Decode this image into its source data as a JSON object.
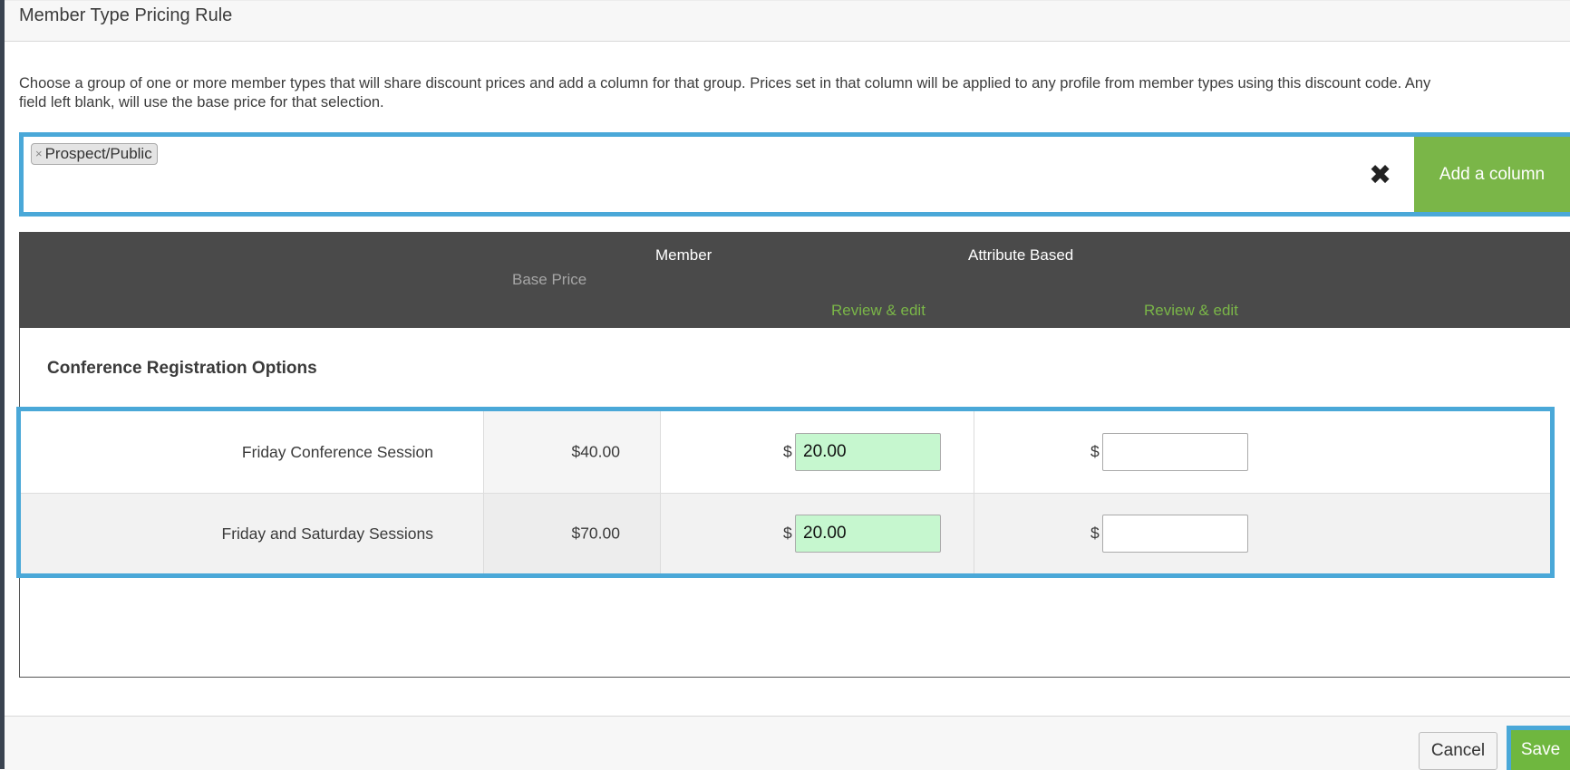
{
  "header": {
    "title": "Member Type Pricing Rule"
  },
  "description": {
    "line1": "Choose a group of one or more member types that will share discount prices and add a column for that group. Prices set in that column will be applied to any profile from member types using this discount code. Any",
    "line2": "field left blank, will use the base price for that selection."
  },
  "selector": {
    "tags": [
      {
        "label": "Prospect/Public",
        "remove_symbol": "×"
      }
    ],
    "clear_symbol": "✖",
    "add_column_label": "Add a column"
  },
  "grid": {
    "columns": {
      "base_price": "Base Price",
      "member": "Member",
      "attribute_based": "Attribute Based",
      "review_edit": "Review & edit"
    },
    "section_title": "Conference Registration Options",
    "currency_symbol": "$",
    "rows": [
      {
        "label": "Friday Conference Session",
        "base_price": "$40.00",
        "member_price": "20.00",
        "attribute_price": ""
      },
      {
        "label": "Friday and Saturday Sessions",
        "base_price": "$70.00",
        "member_price": "20.00",
        "attribute_price": ""
      }
    ]
  },
  "footer": {
    "cancel_label": "Cancel",
    "save_label": "Save"
  },
  "colors": {
    "accent_green": "#7ab648",
    "highlight_blue": "#4aa8d8",
    "header_dark": "#4a4a4a",
    "input_green": "#c6f7cf"
  }
}
